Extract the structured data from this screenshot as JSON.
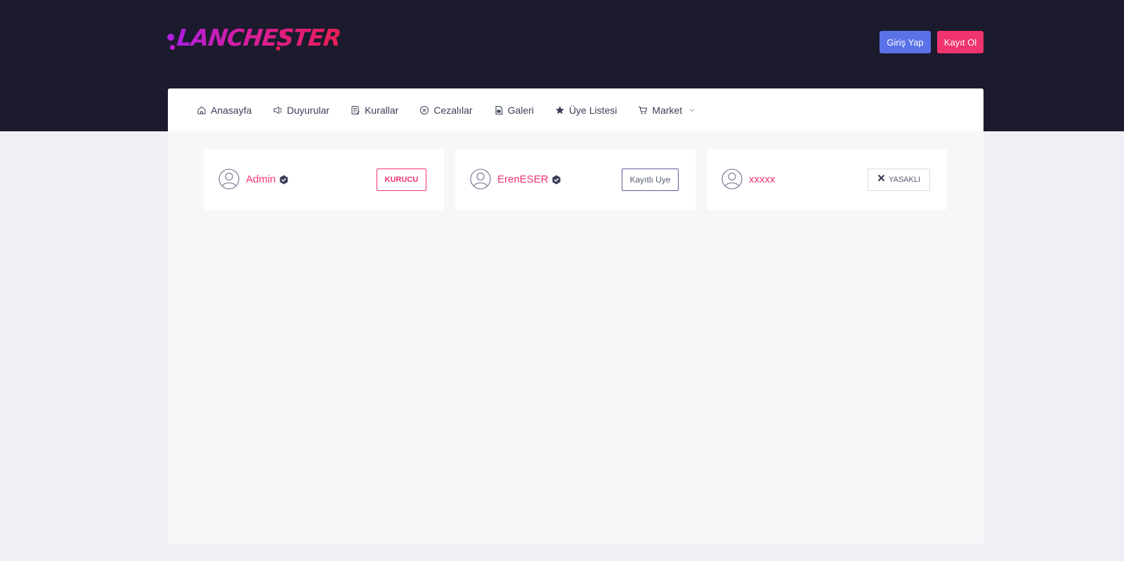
{
  "brand": {
    "logo_text": "LANCHESTER",
    "colors": {
      "topbar": "#1b1b2d",
      "accent_pink": "#f0346f",
      "accent_blue": "#5a72e8"
    }
  },
  "header": {
    "login_label": "Giriş Yap",
    "register_label": "Kayıt Ol"
  },
  "nav": {
    "items": [
      {
        "label": "Anasayfa",
        "icon": "home-icon"
      },
      {
        "label": "Duyurular",
        "icon": "megaphone-icon"
      },
      {
        "label": "Kurallar",
        "icon": "rules-icon"
      },
      {
        "label": "Cezalılar",
        "icon": "circle-x-icon"
      },
      {
        "label": "Galeri",
        "icon": "gallery-icon"
      },
      {
        "label": "Üye Listesi",
        "icon": "star-icon"
      },
      {
        "label": "Market",
        "icon": "cart-icon",
        "dropdown": true
      }
    ]
  },
  "members": [
    {
      "name": "Admin",
      "verified": true,
      "role": "KURUCU"
    },
    {
      "name": "ErenESER",
      "verified": true,
      "role": "Kayıtlı Uye"
    },
    {
      "name": "xxxxx",
      "verified": false,
      "role": "YASAKLI"
    }
  ]
}
